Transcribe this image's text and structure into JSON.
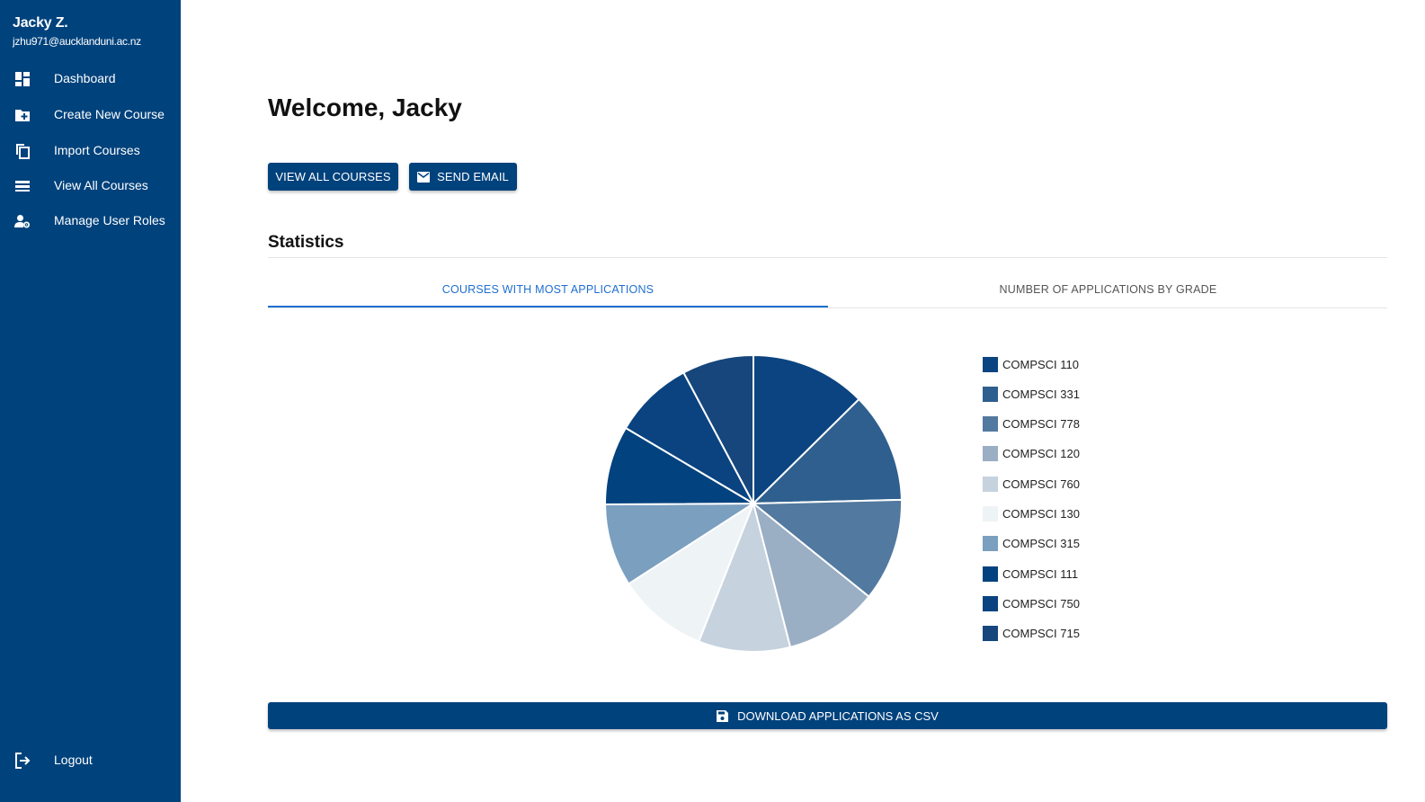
{
  "user": {
    "name": "Jacky Z.",
    "email": "jzhu971@aucklanduni.ac.nz"
  },
  "nav": {
    "dashboard": {
      "label": "Dashboard",
      "icon": "dashboard-icon"
    },
    "create_course": {
      "label": "Create New Course",
      "icon": "create-folder-icon"
    },
    "import_courses": {
      "label": "Import Courses",
      "icon": "copy-icon"
    },
    "view_courses": {
      "label": "View All Courses",
      "icon": "list-icon"
    },
    "manage_roles": {
      "label": "Manage User Roles",
      "icon": "user-settings-icon"
    },
    "logout": {
      "label": "Logout",
      "icon": "logout-icon"
    }
  },
  "main": {
    "welcome": "Welcome, Jacky",
    "view_all_courses": "VIEW ALL COURSES",
    "send_email": "SEND EMAIL",
    "statistics_title": "Statistics",
    "tabs": [
      {
        "label": "COURSES WITH MOST APPLICATIONS",
        "active": true
      },
      {
        "label": "NUMBER OF APPLICATIONS BY GRADE",
        "active": false
      }
    ],
    "download_csv": "DOWNLOAD APPLICATIONS AS CSV"
  },
  "colors": {
    "primary": "#00427c",
    "tab_active": "#1f6fcf"
  },
  "chart_data": {
    "type": "pie",
    "legend_position": "right",
    "categories": [
      "COMPSCI 110",
      "COMPSCI 331",
      "COMPSCI 778",
      "COMPSCI 120",
      "COMPSCI 760",
      "COMPSCI 130",
      "COMPSCI 315",
      "COMPSCI 111",
      "COMPSCI 750",
      "COMPSCI 715"
    ],
    "values": [
      12.6,
      12.0,
      11.2,
      10.2,
      10.0,
      9.9,
      9.0,
      8.6,
      8.7,
      7.8
    ],
    "colors": [
      "#0b4480",
      "#2e5f8e",
      "#52799f",
      "#9aaec4",
      "#c6d2de",
      "#eef3f6",
      "#7a9fbf",
      "#02427e",
      "#0a4380",
      "#16467c"
    ]
  }
}
